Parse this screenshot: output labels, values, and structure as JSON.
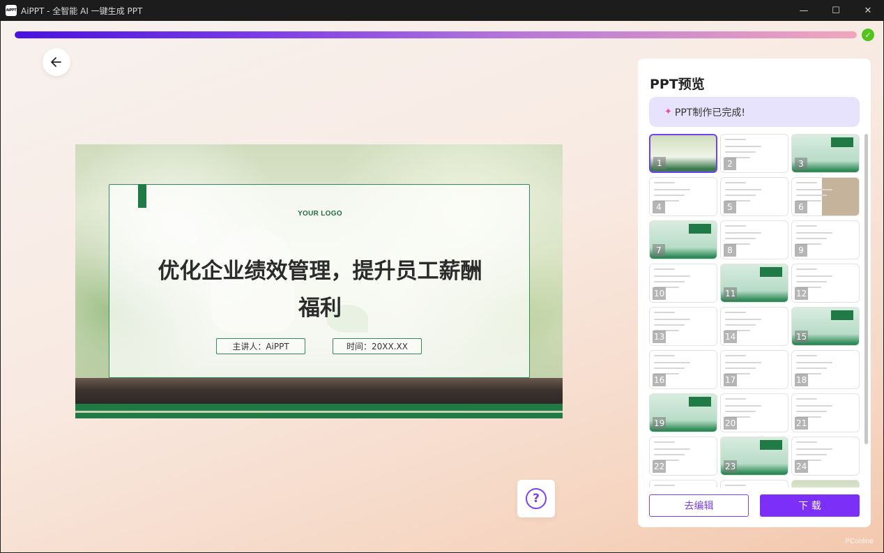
{
  "window": {
    "app_icon_text": "AiPPT",
    "title": "AiPPT - 全智能 AI 一键生成 PPT",
    "controls": [
      "—",
      "☐",
      "✕"
    ]
  },
  "progress": {
    "percent": 100,
    "done_icon": "check-icon"
  },
  "slide": {
    "logo": "YOUR LOGO",
    "title": "优化企业绩效管理，提升员工薪酬福利",
    "presenter": "主讲人：AiPPT",
    "time": "时间：20XX.XX"
  },
  "panel": {
    "title": "PPT预览",
    "banner_icon": "party-popper-icon",
    "banner": "PPT制作已完成!",
    "thumbnails": [
      {
        "num": "1",
        "style": "cover",
        "selected": true
      },
      {
        "num": "2",
        "style": "content"
      },
      {
        "num": "3",
        "style": "section"
      },
      {
        "num": "4",
        "style": "content"
      },
      {
        "num": "5",
        "style": "content"
      },
      {
        "num": "6",
        "style": "photo"
      },
      {
        "num": "7",
        "style": "section"
      },
      {
        "num": "8",
        "style": "content"
      },
      {
        "num": "9",
        "style": "content"
      },
      {
        "num": "10",
        "style": "content"
      },
      {
        "num": "11",
        "style": "section"
      },
      {
        "num": "12",
        "style": "content"
      },
      {
        "num": "13",
        "style": "content"
      },
      {
        "num": "14",
        "style": "content"
      },
      {
        "num": "15",
        "style": "section"
      },
      {
        "num": "16",
        "style": "content"
      },
      {
        "num": "17",
        "style": "content"
      },
      {
        "num": "18",
        "style": "content"
      },
      {
        "num": "19",
        "style": "section"
      },
      {
        "num": "20",
        "style": "content"
      },
      {
        "num": "21",
        "style": "content"
      },
      {
        "num": "22",
        "style": "content"
      },
      {
        "num": "23",
        "style": "section"
      },
      {
        "num": "24",
        "style": "content"
      },
      {
        "num": "",
        "style": "content"
      },
      {
        "num": "",
        "style": "content"
      },
      {
        "num": "",
        "style": "cover"
      }
    ],
    "edit_button": "去编辑",
    "download_button": "下 载"
  },
  "help": {
    "label": "?"
  },
  "watermark": "PConline",
  "colors": {
    "accent": "#7b2ff7",
    "success": "#52c41a",
    "slide_green": "#1f7a45"
  }
}
